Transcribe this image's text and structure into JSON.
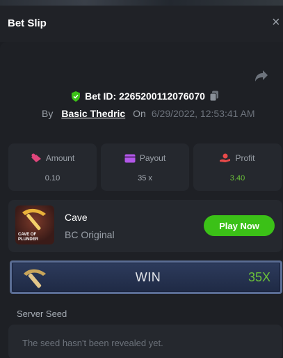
{
  "header": {
    "title": "Bet Slip",
    "close_symbol": "×"
  },
  "bet": {
    "id_label": "Bet ID: 2265200112076070",
    "by_label": "By",
    "user": "Basic Thedric",
    "on_label": "On",
    "datetime": "6/29/2022, 12:53:41 AM"
  },
  "stats": {
    "amount": {
      "label": "Amount",
      "value": "0.10"
    },
    "payout": {
      "label": "Payout",
      "value": "35 x"
    },
    "profit": {
      "label": "Profit",
      "value": "3.40"
    }
  },
  "game": {
    "name": "Cave",
    "provider": "BC Original",
    "thumb_caption": "CAVE OF PLUNDER",
    "play_label": "Play Now"
  },
  "result": {
    "label": "WIN",
    "multiplier": "35X"
  },
  "server_seed": {
    "label": "Server Seed",
    "placeholder": "The seed hasn't been revealed yet."
  },
  "colors": {
    "accent_green": "#3bc117",
    "profit_green": "#6bc13a",
    "background": "#1e2025",
    "card": "#25282e"
  },
  "icons": [
    "close-icon",
    "share-icon",
    "verified-shield-icon",
    "copy-icon",
    "amount-icon",
    "payout-icon",
    "profit-icon",
    "game-thumbnail",
    "pickaxe-icon"
  ]
}
